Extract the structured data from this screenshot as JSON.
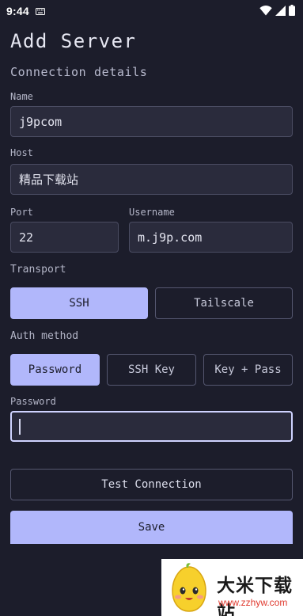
{
  "status_bar": {
    "time": "9:44",
    "icons": [
      "keyboard-icon",
      "wifi-icon",
      "signal-icon",
      "battery-icon"
    ]
  },
  "page": {
    "title": "Add Server",
    "section_title": "Connection details"
  },
  "form": {
    "name": {
      "label": "Name",
      "value": "j9pcom"
    },
    "host": {
      "label": "Host",
      "value": "精品下载站"
    },
    "port": {
      "label": "Port",
      "value": "22"
    },
    "username": {
      "label": "Username",
      "value": "m.j9p.com"
    },
    "transport": {
      "label": "Transport",
      "options": [
        "SSH",
        "Tailscale"
      ],
      "selected": "SSH"
    },
    "auth_method": {
      "label": "Auth method",
      "options": [
        "Password",
        "SSH Key",
        "Key + Pass"
      ],
      "selected": "Password"
    },
    "password": {
      "label": "Password",
      "value": ""
    }
  },
  "actions": {
    "test_connection": "Test Connection",
    "save": "Save"
  },
  "watermark": {
    "title": "大米下载站",
    "url": "www.zzhyw.com"
  },
  "colors": {
    "background": "#1c1d2b",
    "accent": "#b1b7fb",
    "field_bg": "#2a2b3c",
    "border": "#555770"
  }
}
